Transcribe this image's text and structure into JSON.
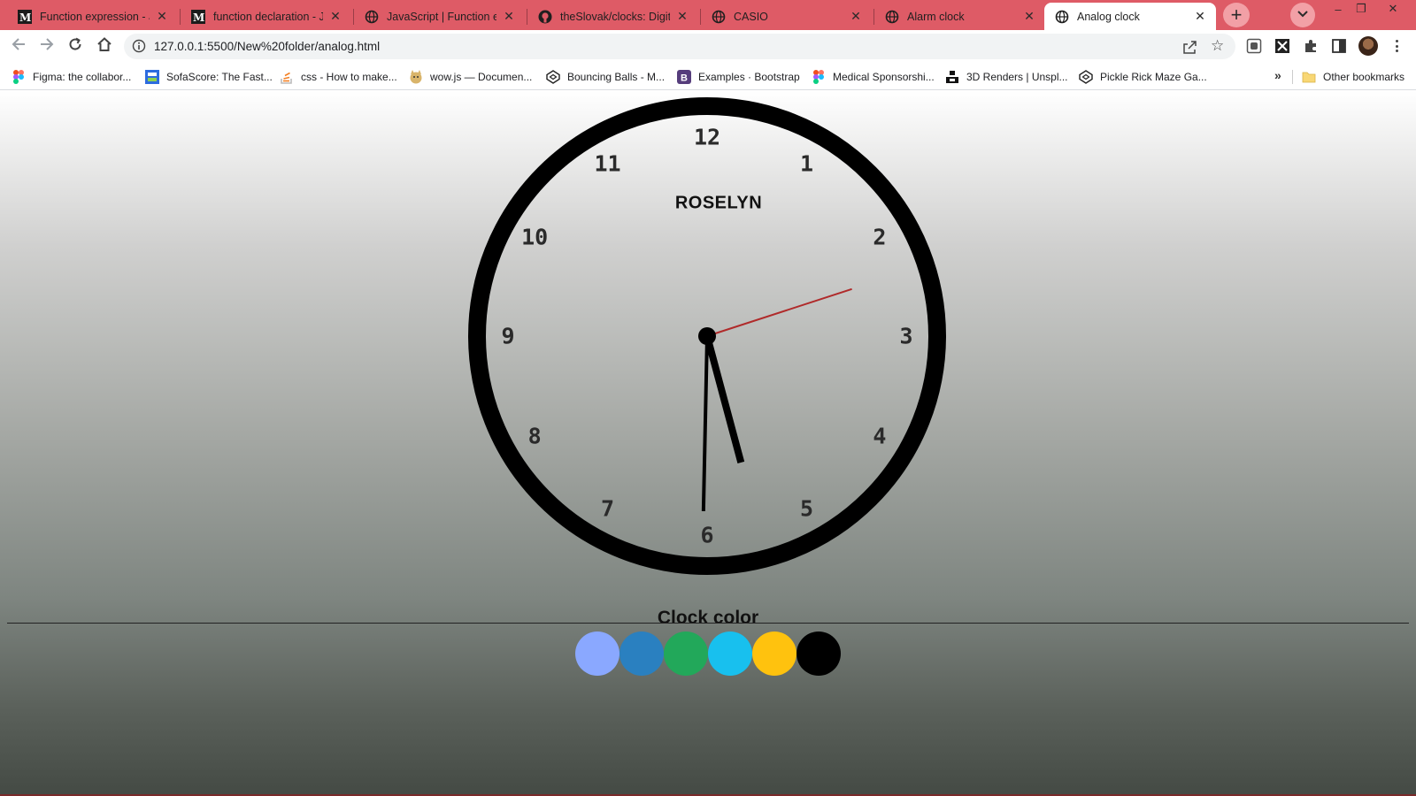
{
  "browser": {
    "tabs": [
      {
        "title": "Function expression - JavaScript | MDN",
        "icon": "mdn-icon",
        "active": false
      },
      {
        "title": "function declaration - JavaScript | MDN",
        "icon": "mdn-icon",
        "active": false
      },
      {
        "title": "JavaScript | Function expression",
        "icon": "globe-icon",
        "active": false
      },
      {
        "title": "theSlovak/clocks: Digital",
        "icon": "github-icon",
        "active": false
      },
      {
        "title": "CASIO",
        "icon": "globe-icon",
        "active": false
      },
      {
        "title": "Alarm clock",
        "icon": "globe-icon",
        "active": false
      },
      {
        "title": "Analog clock",
        "icon": "globe-icon",
        "active": true
      }
    ],
    "new_tab_symbol": "+",
    "close_symbol": "✕",
    "window_controls": {
      "minimize": "–",
      "restore": "❐",
      "close": "✕"
    },
    "address_bar": {
      "url": "127.0.0.1:5500/New%20folder/analog.html"
    },
    "bookmarks": [
      {
        "label": "Figma: the collabor...",
        "icon": "figma-icon"
      },
      {
        "label": "SofaScore: The Fast...",
        "icon": "sofascore-icon"
      },
      {
        "label": "css - How to make...",
        "icon": "stackoverflow-icon"
      },
      {
        "label": "wow.js — Documen...",
        "icon": "doge-icon"
      },
      {
        "label": "Bouncing Balls - M...",
        "icon": "codepen-icon"
      },
      {
        "label": "Examples · Bootstrap",
        "icon": "bootstrap-icon"
      },
      {
        "label": "Medical Sponsorshi...",
        "icon": "figma-icon"
      },
      {
        "label": "3D Renders | Unspl...",
        "icon": "unsplash-icon"
      },
      {
        "label": "Pickle Rick Maze Ga...",
        "icon": "codepen-icon"
      }
    ],
    "bookmarks_overflow": "»",
    "other_bookmarks": "Other bookmarks"
  },
  "page": {
    "clock": {
      "brand": "ROSELYN",
      "numerals": [
        "12",
        "1",
        "2",
        "3",
        "4",
        "5",
        "6",
        "7",
        "8",
        "9",
        "10",
        "11"
      ],
      "time": {
        "hour": 5,
        "minute": 30,
        "second": 12
      },
      "colors": {
        "rim": "#000000",
        "hour_hand": "#000000",
        "minute_hand": "#000000",
        "second_hand": "#b02a2a",
        "numerals": "#2a2a2a"
      }
    },
    "color_picker": {
      "title": "Clock color",
      "swatches": [
        {
          "name": "light-blue",
          "color": "#8aa8ff"
        },
        {
          "name": "steel-blue",
          "color": "#2a80c0"
        },
        {
          "name": "green",
          "color": "#22a85a"
        },
        {
          "name": "sky-blue",
          "color": "#18c0ee"
        },
        {
          "name": "amber",
          "color": "#ffc20e"
        },
        {
          "name": "black",
          "color": "#000000"
        }
      ]
    }
  }
}
